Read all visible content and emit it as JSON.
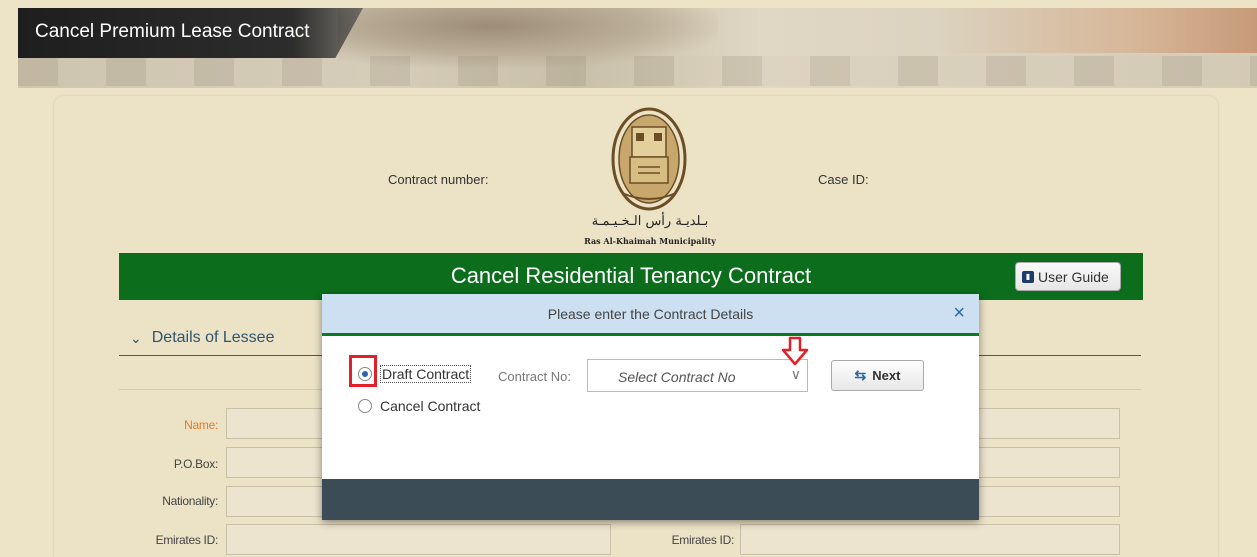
{
  "header": {
    "title": "Cancel Premium Lease Contract"
  },
  "info": {
    "contract_number_label": "Contract number:",
    "case_id_label": "Case ID:"
  },
  "logo": {
    "arabic_text": "بـلديـة رأس الـخـيـمـة",
    "english_text": "Ras Al-Khaimah Municipality"
  },
  "banner": {
    "title": "Cancel Residential Tenancy Contract",
    "user_guide_label": "User Guide"
  },
  "section": {
    "title": "Details of Lessee"
  },
  "form": {
    "name_label": "Name:",
    "pobox_label": "P.O.Box:",
    "nationality_label": "Nationality:",
    "emirates_id_label": "Emirates ID:",
    "emirates_id_label_right": "Emirates ID:"
  },
  "dialog": {
    "title": "Please enter the Contract Details",
    "close_symbol": "×",
    "option_draft": "Draft Contract",
    "option_cancel": "Cancel Contract",
    "selected_option": "Draft Contract",
    "contract_no_label": "Contract No:",
    "contract_no_placeholder": "Select Contract No",
    "next_label": "Next"
  },
  "colors": {
    "green_bar": "#0c6e1c",
    "dialog_header": "#cde0f1",
    "dialog_footer": "#3c4c56",
    "highlight_red": "#e0202a"
  }
}
